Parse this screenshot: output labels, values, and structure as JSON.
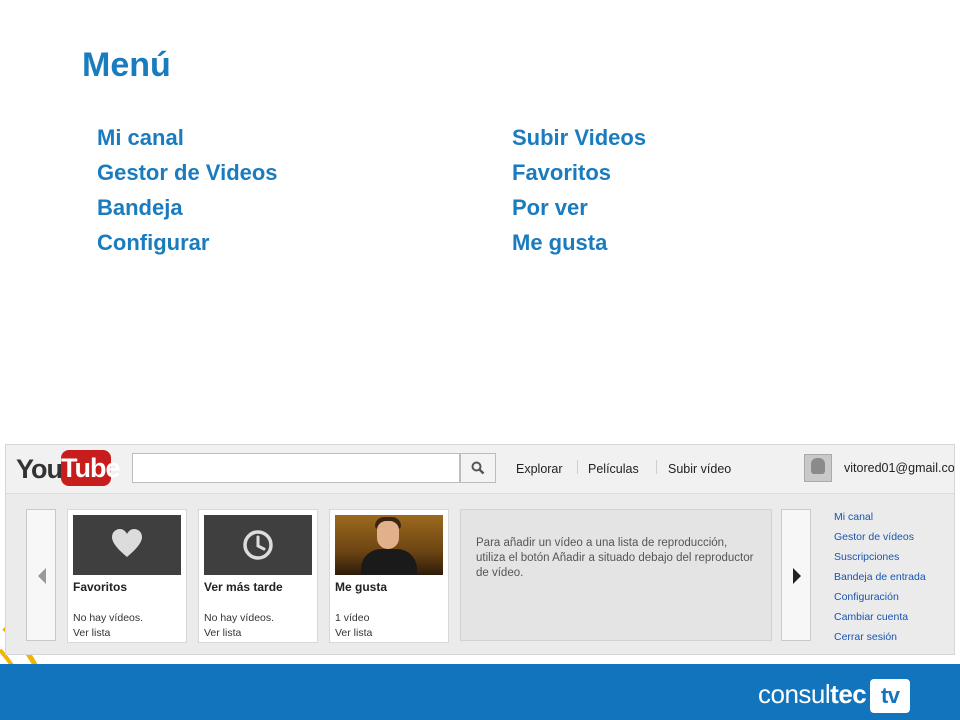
{
  "slide": {
    "title": "Menú",
    "menu_left": [
      "Mi canal",
      "Gestor de Videos",
      "Bandeja",
      "Configurar"
    ],
    "menu_right": [
      "Subir Videos",
      "Favoritos",
      "Por ver",
      "Me gusta"
    ]
  },
  "youtube": {
    "logo_you": "You",
    "logo_tube": "Tube",
    "search_placeholder": "",
    "nav": [
      "Explorar",
      "Películas",
      "Subir vídeo"
    ],
    "account": "vitored01@gmail.co",
    "cards": [
      {
        "title": "Favoritos",
        "info": "No hay vídeos.",
        "link": "Ver lista",
        "icon": "heart-icon"
      },
      {
        "title": "Ver más tarde",
        "info": "No hay vídeos.",
        "link": "Ver lista",
        "icon": "clock-icon"
      },
      {
        "title": "Me gusta",
        "info": "1 vídeo",
        "link": "Ver lista",
        "icon": "video-thumbnail"
      }
    ],
    "info_text": "Para añadir un vídeo a una lista de reproducción, utiliza el botón Añadir a situado debajo del reproductor de vídeo.",
    "side_links": [
      "Mi canal",
      "Gestor de vídeos",
      "Suscripciones",
      "Bandeja de entrada",
      "Configuración",
      "Cambiar cuenta",
      "Cerrar sesión"
    ]
  },
  "footer": {
    "brand_light": "consul",
    "brand_bold": "tec",
    "brand_tv": "tv"
  },
  "colors": {
    "accent": "#1a7bbf",
    "footer": "#1274bd",
    "yt_red": "#c81d1d",
    "link": "#1a55b0"
  }
}
